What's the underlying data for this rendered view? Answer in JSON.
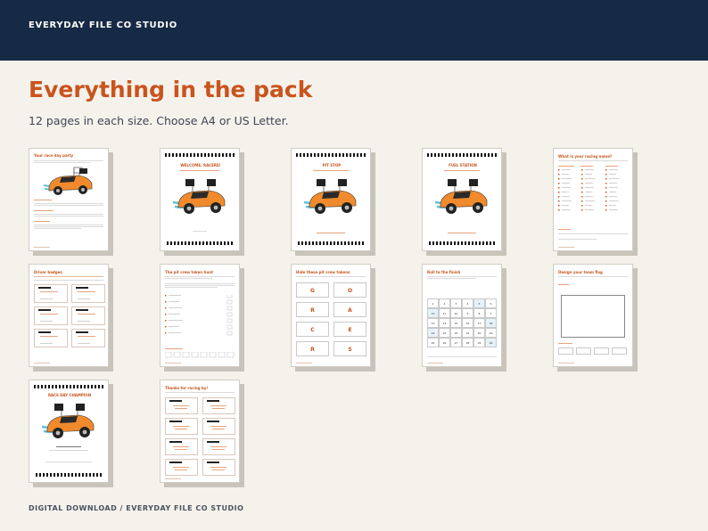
{
  "header": {
    "brand": "EVERYDAY FILE CO STUDIO",
    "background": "#172a45"
  },
  "main": {
    "title": "Everything in the pack",
    "subtitle": "12 pages in each size. Choose A4 or US Letter.",
    "accent": "#c9541d"
  },
  "pages": [
    {
      "title": "Your race day party"
    },
    {
      "title": "WELCOME, RACERS!"
    },
    {
      "title": "PIT STOP"
    },
    {
      "title": "FUEL STATION"
    },
    {
      "title": "What is your racing name?"
    },
    {
      "title": "Driver badges"
    },
    {
      "title": "The pit crew token hunt"
    },
    {
      "title": "Hide these pit crew tokens"
    },
    {
      "title": "Roll to the finish"
    },
    {
      "title": "Design your team flag"
    },
    {
      "title": "RACE DAY CHAMPION"
    },
    {
      "title": "Thanks for racing by!"
    }
  ],
  "tokens": [
    "G",
    "O",
    "R",
    "A",
    "C",
    "E",
    "R",
    "S"
  ],
  "board": [
    "1",
    "2",
    "3",
    "4",
    "5",
    "6",
    "12",
    "11",
    "10",
    "9",
    "8",
    "7",
    "13",
    "14",
    "15",
    "16",
    "17",
    "18",
    "24",
    "23",
    "22",
    "21",
    "20",
    "19",
    "25",
    "26",
    "27",
    "28",
    "29",
    "30"
  ],
  "footer": {
    "text": "DIGITAL DOWNLOAD  /  EVERYDAY FILE CO STUDIO"
  }
}
